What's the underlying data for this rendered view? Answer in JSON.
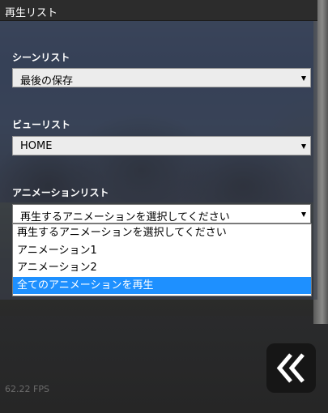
{
  "panel": {
    "title": "再生リスト",
    "scene": {
      "label": "シーンリスト",
      "selected": "最後の保存"
    },
    "view": {
      "label": "ビューリスト",
      "selected": "HOME"
    },
    "animation": {
      "label": "アニメーションリスト",
      "selected": "再生するアニメーションを選択してください",
      "options": [
        "再生するアニメーションを選択してください",
        "アニメーション1",
        "アニメーション2",
        "全てのアニメーションを再生"
      ],
      "highlighted_option": "全てのアニメーションを再生"
    }
  },
  "fps": "62.22 FPS",
  "toggle": {
    "icon": "double-chevron-left-icon"
  },
  "colors": {
    "highlight": "#1e90ff",
    "titlebar": "#2c2c2c",
    "toggle_bg": "#161616"
  }
}
